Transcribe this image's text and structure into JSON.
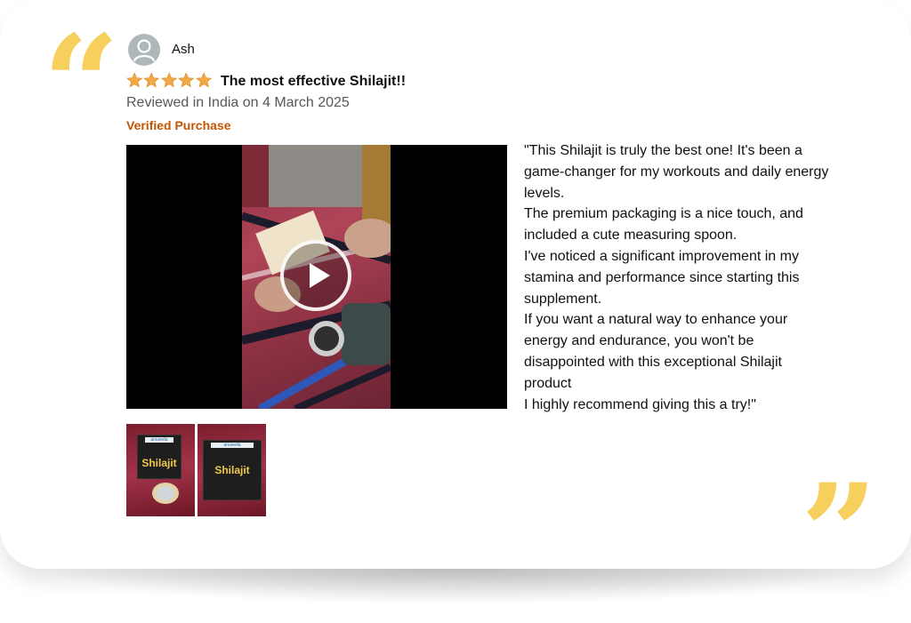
{
  "reviewer": {
    "name": "Ash"
  },
  "review": {
    "rating": 5,
    "rating_max": 5,
    "title": "The most effective Shilajit!!",
    "meta": "Reviewed in India on 4 March 2025",
    "verified": "Verified Purchase",
    "body": "\"This Shilajit is truly the best one! It's been a game-changer for my workouts and daily energy levels.\nThe premium packaging is a nice touch, and included a cute measuring spoon.\nI've noticed a significant improvement in my stamina and performance since starting this supplement.\nIf you want a natural way to enhance your energy and endurance, you won't be disappointed with this exceptional Shilajit product\nI highly recommend giving this a try!\""
  },
  "media": {
    "thumbnails": [
      {
        "brand": "anuveda",
        "product": "Shilajit"
      },
      {
        "brand": "anuveda",
        "product": "Shilajit"
      }
    ]
  },
  "decor": {
    "open_quote": "“",
    "close_quote": "”"
  },
  "colors": {
    "quote": "#f7cf5c",
    "star": "#f3a847",
    "verified": "#c45500",
    "meta": "#565959"
  }
}
